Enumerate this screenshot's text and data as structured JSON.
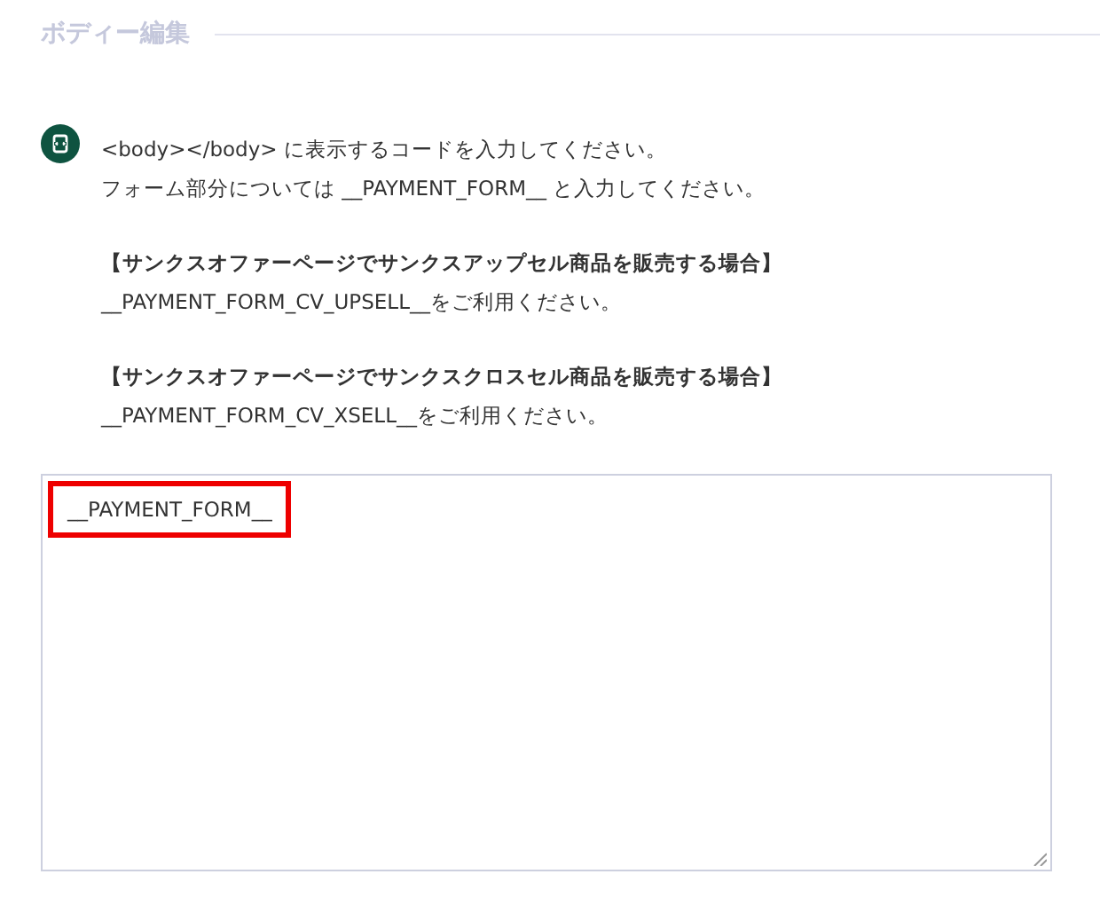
{
  "section": {
    "title": "ボディー編集"
  },
  "info": {
    "paragraphs": [
      {
        "lines": [
          "<body></body> に表示するコードを入力してください。",
          "フォーム部分については __PAYMENT_FORM__ と入力してください。"
        ]
      },
      {
        "heading": "【サンクスオファーページでサンクスアップセル商品を販売する場合】",
        "lines": [
          "__PAYMENT_FORM_CV_UPSELL__をご利用ください。"
        ]
      },
      {
        "heading": "【サンクスオファーページでサンクスクロスセル商品を販売する場合】",
        "lines": [
          "__PAYMENT_FORM_CV_XSELL__をご利用ください。"
        ]
      }
    ]
  },
  "editor": {
    "value": "__PAYMENT_FORM__",
    "highlighted": true
  }
}
